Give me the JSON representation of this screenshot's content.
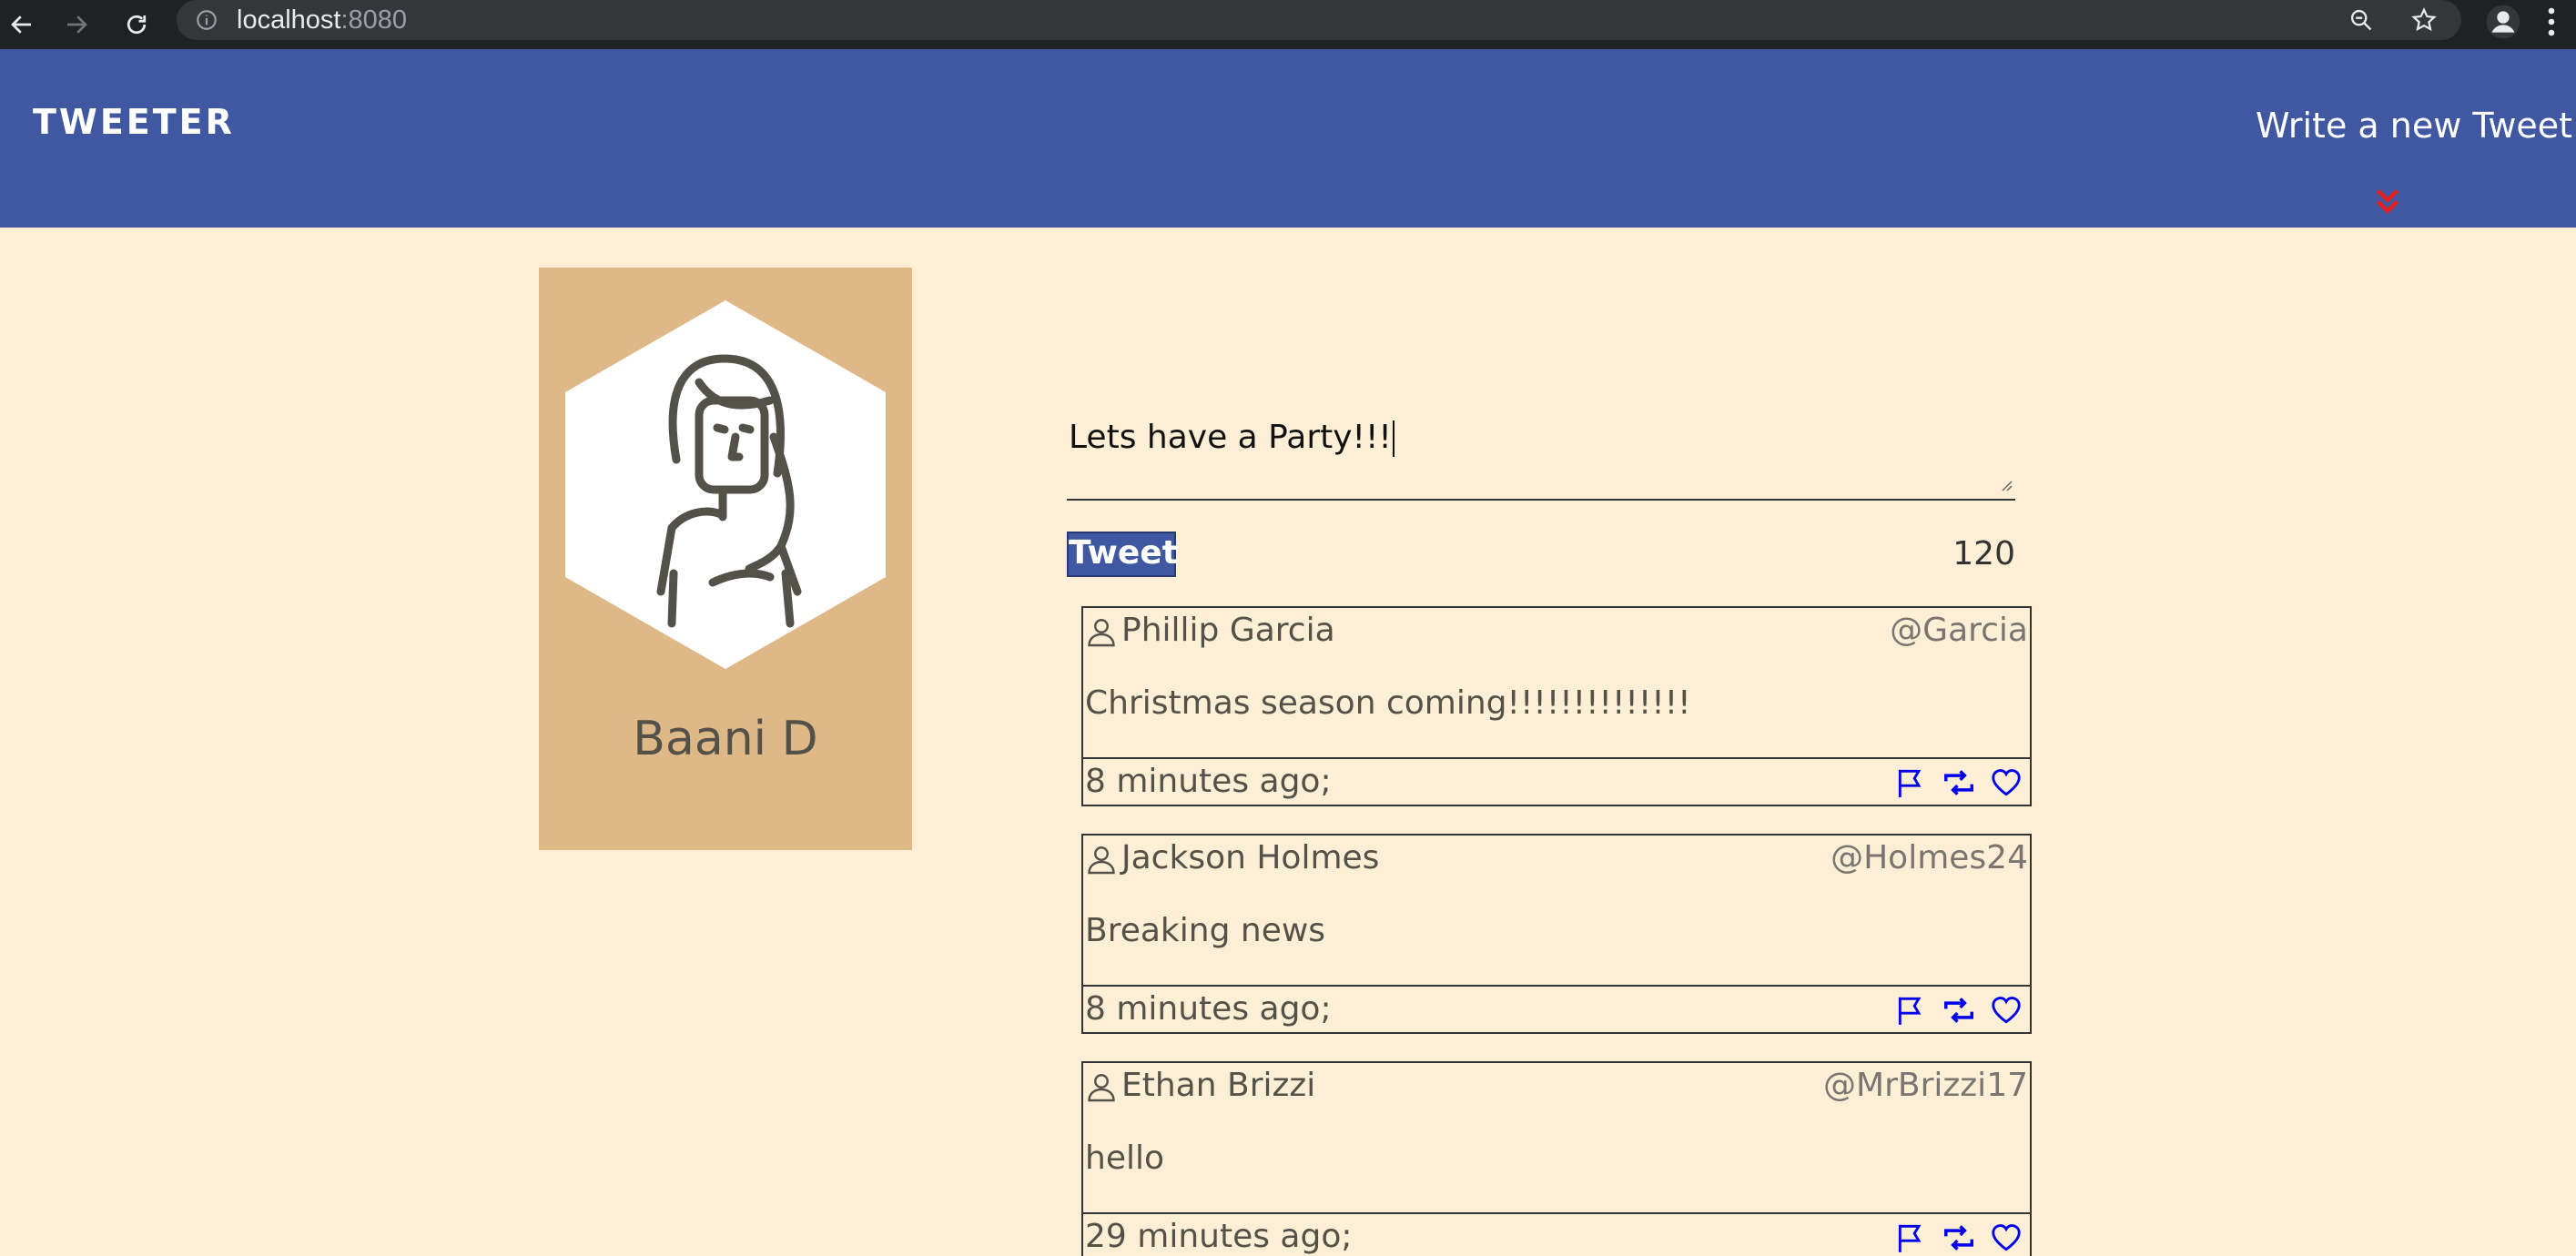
{
  "browser": {
    "url_host": "localhost",
    "url_port": ":8080"
  },
  "header": {
    "logo": "TWEETER",
    "compose_label": "Write a new Tweet"
  },
  "profile": {
    "name": "Baani D"
  },
  "composer": {
    "text": "Lets have a Party!!!",
    "button_label": "Tweet",
    "char_count": "120"
  },
  "tweets": [
    {
      "name": "Phillip Garcia",
      "handle": "@Garcia",
      "body": "Christmas season coming!!!!!!!!!!!!!!",
      "time": "8 minutes ago;"
    },
    {
      "name": "Jackson Holmes",
      "handle": "@Holmes24",
      "body": "Breaking news",
      "time": "8 minutes ago;"
    },
    {
      "name": "Ethan Brizzi",
      "handle": "@MrBrizzi17",
      "body": "hello",
      "time": "29 minutes ago;"
    }
  ],
  "colors": {
    "header_bg": "#4058a1",
    "page_bg": "#fdefd6",
    "profile_bg": "#deb887",
    "action_icons": "#0000ee",
    "chevron": "#e0201c"
  }
}
